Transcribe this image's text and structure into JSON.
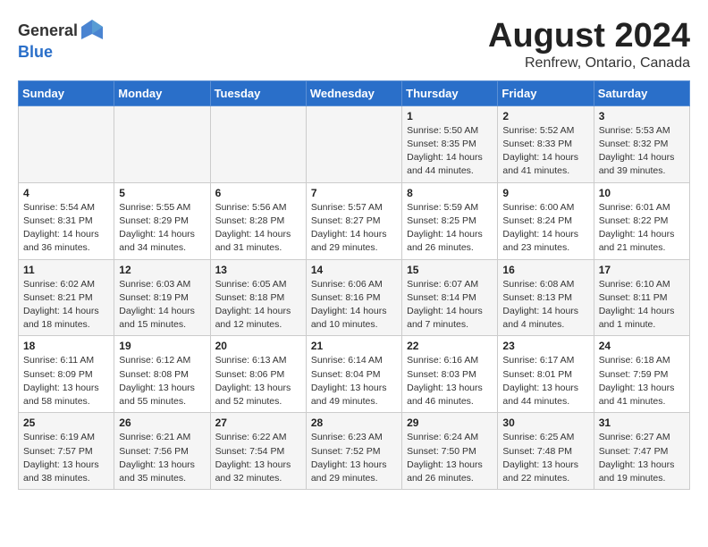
{
  "header": {
    "logo_general": "General",
    "logo_blue": "Blue",
    "month_title": "August 2024",
    "location": "Renfrew, Ontario, Canada"
  },
  "weekdays": [
    "Sunday",
    "Monday",
    "Tuesday",
    "Wednesday",
    "Thursday",
    "Friday",
    "Saturday"
  ],
  "weeks": [
    [
      {
        "day": "",
        "info": ""
      },
      {
        "day": "",
        "info": ""
      },
      {
        "day": "",
        "info": ""
      },
      {
        "day": "",
        "info": ""
      },
      {
        "day": "1",
        "info": "Sunrise: 5:50 AM\nSunset: 8:35 PM\nDaylight: 14 hours\nand 44 minutes."
      },
      {
        "day": "2",
        "info": "Sunrise: 5:52 AM\nSunset: 8:33 PM\nDaylight: 14 hours\nand 41 minutes."
      },
      {
        "day": "3",
        "info": "Sunrise: 5:53 AM\nSunset: 8:32 PM\nDaylight: 14 hours\nand 39 minutes."
      }
    ],
    [
      {
        "day": "4",
        "info": "Sunrise: 5:54 AM\nSunset: 8:31 PM\nDaylight: 14 hours\nand 36 minutes."
      },
      {
        "day": "5",
        "info": "Sunrise: 5:55 AM\nSunset: 8:29 PM\nDaylight: 14 hours\nand 34 minutes."
      },
      {
        "day": "6",
        "info": "Sunrise: 5:56 AM\nSunset: 8:28 PM\nDaylight: 14 hours\nand 31 minutes."
      },
      {
        "day": "7",
        "info": "Sunrise: 5:57 AM\nSunset: 8:27 PM\nDaylight: 14 hours\nand 29 minutes."
      },
      {
        "day": "8",
        "info": "Sunrise: 5:59 AM\nSunset: 8:25 PM\nDaylight: 14 hours\nand 26 minutes."
      },
      {
        "day": "9",
        "info": "Sunrise: 6:00 AM\nSunset: 8:24 PM\nDaylight: 14 hours\nand 23 minutes."
      },
      {
        "day": "10",
        "info": "Sunrise: 6:01 AM\nSunset: 8:22 PM\nDaylight: 14 hours\nand 21 minutes."
      }
    ],
    [
      {
        "day": "11",
        "info": "Sunrise: 6:02 AM\nSunset: 8:21 PM\nDaylight: 14 hours\nand 18 minutes."
      },
      {
        "day": "12",
        "info": "Sunrise: 6:03 AM\nSunset: 8:19 PM\nDaylight: 14 hours\nand 15 minutes."
      },
      {
        "day": "13",
        "info": "Sunrise: 6:05 AM\nSunset: 8:18 PM\nDaylight: 14 hours\nand 12 minutes."
      },
      {
        "day": "14",
        "info": "Sunrise: 6:06 AM\nSunset: 8:16 PM\nDaylight: 14 hours\nand 10 minutes."
      },
      {
        "day": "15",
        "info": "Sunrise: 6:07 AM\nSunset: 8:14 PM\nDaylight: 14 hours\nand 7 minutes."
      },
      {
        "day": "16",
        "info": "Sunrise: 6:08 AM\nSunset: 8:13 PM\nDaylight: 14 hours\nand 4 minutes."
      },
      {
        "day": "17",
        "info": "Sunrise: 6:10 AM\nSunset: 8:11 PM\nDaylight: 14 hours\nand 1 minute."
      }
    ],
    [
      {
        "day": "18",
        "info": "Sunrise: 6:11 AM\nSunset: 8:09 PM\nDaylight: 13 hours\nand 58 minutes."
      },
      {
        "day": "19",
        "info": "Sunrise: 6:12 AM\nSunset: 8:08 PM\nDaylight: 13 hours\nand 55 minutes."
      },
      {
        "day": "20",
        "info": "Sunrise: 6:13 AM\nSunset: 8:06 PM\nDaylight: 13 hours\nand 52 minutes."
      },
      {
        "day": "21",
        "info": "Sunrise: 6:14 AM\nSunset: 8:04 PM\nDaylight: 13 hours\nand 49 minutes."
      },
      {
        "day": "22",
        "info": "Sunrise: 6:16 AM\nSunset: 8:03 PM\nDaylight: 13 hours\nand 46 minutes."
      },
      {
        "day": "23",
        "info": "Sunrise: 6:17 AM\nSunset: 8:01 PM\nDaylight: 13 hours\nand 44 minutes."
      },
      {
        "day": "24",
        "info": "Sunrise: 6:18 AM\nSunset: 7:59 PM\nDaylight: 13 hours\nand 41 minutes."
      }
    ],
    [
      {
        "day": "25",
        "info": "Sunrise: 6:19 AM\nSunset: 7:57 PM\nDaylight: 13 hours\nand 38 minutes."
      },
      {
        "day": "26",
        "info": "Sunrise: 6:21 AM\nSunset: 7:56 PM\nDaylight: 13 hours\nand 35 minutes."
      },
      {
        "day": "27",
        "info": "Sunrise: 6:22 AM\nSunset: 7:54 PM\nDaylight: 13 hours\nand 32 minutes."
      },
      {
        "day": "28",
        "info": "Sunrise: 6:23 AM\nSunset: 7:52 PM\nDaylight: 13 hours\nand 29 minutes."
      },
      {
        "day": "29",
        "info": "Sunrise: 6:24 AM\nSunset: 7:50 PM\nDaylight: 13 hours\nand 26 minutes."
      },
      {
        "day": "30",
        "info": "Sunrise: 6:25 AM\nSunset: 7:48 PM\nDaylight: 13 hours\nand 22 minutes."
      },
      {
        "day": "31",
        "info": "Sunrise: 6:27 AM\nSunset: 7:47 PM\nDaylight: 13 hours\nand 19 minutes."
      }
    ]
  ]
}
